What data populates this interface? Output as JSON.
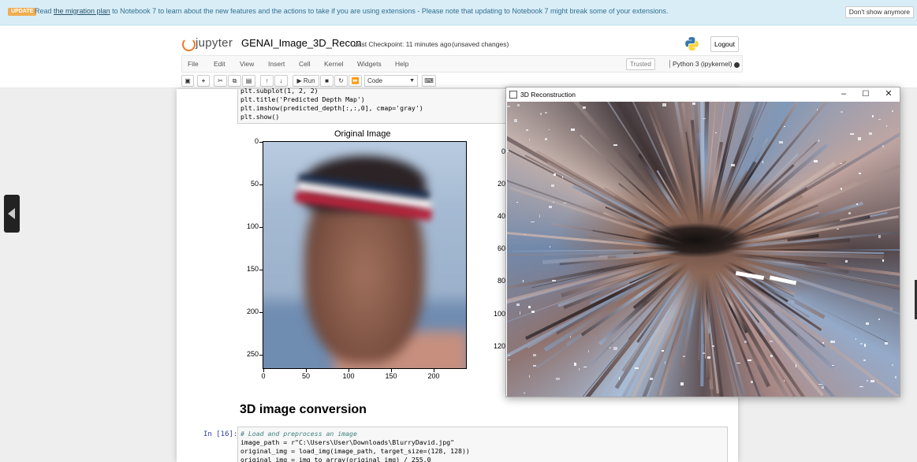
{
  "banner": {
    "badge": "UPDATE",
    "pre": "Read ",
    "link": "the migration plan",
    "post": " to Notebook 7 to learn about the new features and the actions to take if you are using extensions - Please note that updating to Notebook 7 might break some of your extensions.",
    "dismiss": "Don't show anymore"
  },
  "header": {
    "logo_text": "jupyter",
    "notebook_title": "GENAI_Image_3D_Recon",
    "checkpoint": "Last Checkpoint: 11 minutes ago",
    "unsaved": "(unsaved changes)",
    "logout": "Logout"
  },
  "menubar": {
    "items": [
      "File",
      "Edit",
      "View",
      "Insert",
      "Cell",
      "Kernel",
      "Widgets",
      "Help"
    ],
    "trusted": "Trusted",
    "kernel": "Python 3 (ipykernel)"
  },
  "toolbar": {
    "run_label": "Run",
    "cell_type": "Code"
  },
  "code_top": {
    "lines": [
      "plt.subplot(1, 2, 2)",
      "plt.title('Predicted Depth Map')",
      "plt.imshow(predicted_depth[:,:,0], cmap='gray')",
      "plt.show()"
    ]
  },
  "plot": {
    "title": "Original Image",
    "yticks": [
      "0",
      "50",
      "100",
      "150",
      "200",
      "250"
    ],
    "xticks": [
      "0",
      "50",
      "100",
      "150",
      "200"
    ],
    "right_yticks": [
      "0",
      "20",
      "40",
      "60",
      "80",
      "100",
      "120"
    ]
  },
  "section": {
    "title": "3D image conversion"
  },
  "code_cell": {
    "prompt": "In [16]:",
    "lines": [
      "# Load and preprocess an image",
      "image_path = r\"C:\\Users\\User\\Downloads\\BlurryDavid.jpg\"",
      "original_img = load_img(image_path, target_size=(128, 128))",
      "original_img = img_to_array(original_img) / 255.0"
    ]
  },
  "window3d": {
    "title": "3D Reconstruction",
    "minimize": "–",
    "maximize": "☐",
    "close": "✕"
  },
  "colors": {
    "banner_bg": "#d9edf7",
    "update_badge": "#f0ad4e",
    "jupyter_orange": "#f37726",
    "prompt_blue": "#303f9f"
  }
}
